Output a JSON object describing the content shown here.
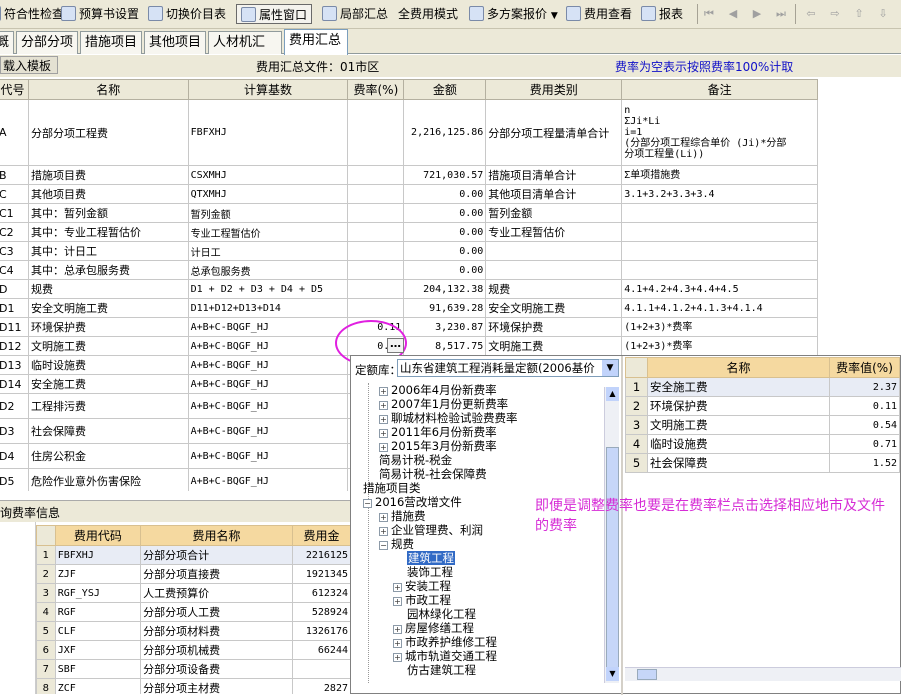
{
  "toolbar": {
    "items": [
      {
        "label": "符合性检查",
        "icon": "check-icon"
      },
      {
        "label": "预算书设置",
        "icon": "settings-icon"
      },
      {
        "label": "切换价目表",
        "icon": "switch-icon"
      },
      {
        "label": "属性窗口",
        "icon": "property-window-icon"
      },
      {
        "label": "局部汇总",
        "icon": "partial-summary-icon"
      },
      {
        "label": "全费用模式",
        "icon": ""
      },
      {
        "label": "多方案报价",
        "icon": "multi-plan-icon"
      },
      {
        "label": "费用查看",
        "icon": "cost-view-icon"
      },
      {
        "label": "报表",
        "icon": "report-icon"
      }
    ]
  },
  "tabs": [
    "概况",
    "分部分项",
    "措施项目",
    "其他项目",
    "人材机汇总",
    "费用汇总"
  ],
  "subbar": {
    "load_template": "载入模板",
    "file_label": "费用汇总文件：01市区",
    "note": "费率为空表示按照费率100%计取"
  },
  "main_table": {
    "headers": [
      "代号",
      "名称",
      "计算基数",
      "费率(%)",
      "金额",
      "费用类别",
      "备注"
    ],
    "rows": [
      {
        "code": "A",
        "name": "分部分项工程费",
        "base": "FBFXHJ",
        "rate": "",
        "amount": "2,216,125.86",
        "category": "分部分项工程量清单合计",
        "note_lines": [
          "n",
          "ΣJi*Li",
          "i=1",
          "(分部分项工程综合单价 (Ji)*分部",
          "分项工程量(Li))"
        ]
      },
      {
        "code": "B",
        "name": "措施项目费",
        "base": "CSXMHJ",
        "rate": "",
        "amount": "721,030.57",
        "category": "措施项目清单合计",
        "note_lines": [
          "Σ单项措施费"
        ]
      },
      {
        "code": "C",
        "name": "其他项目费",
        "base": "QTXMHJ",
        "rate": "",
        "amount": "0.00",
        "category": "其他项目清单合计",
        "note_lines": [
          "3.1+3.2+3.3+3.4"
        ]
      },
      {
        "code": "C1",
        "name": "其中：暂列金额",
        "base": "暂列金额",
        "rate": "",
        "amount": "0.00",
        "category": "暂列金额",
        "note_lines": [
          ""
        ]
      },
      {
        "code": "C2",
        "name": "其中：专业工程暂估价",
        "base": "专业工程暂估价",
        "rate": "",
        "amount": "0.00",
        "category": "专业工程暂估价",
        "note_lines": [
          ""
        ]
      },
      {
        "code": "C3",
        "name": "其中：计日工",
        "base": "计日工",
        "rate": "",
        "amount": "0.00",
        "category": "",
        "note_lines": [
          ""
        ]
      },
      {
        "code": "C4",
        "name": "其中：总承包服务费",
        "base": "总承包服务费",
        "rate": "",
        "amount": "0.00",
        "category": "",
        "note_lines": [
          ""
        ]
      },
      {
        "code": "D",
        "name": "规费",
        "base": "D1 + D2 + D3 + D4 + D5",
        "rate": "",
        "amount": "204,132.38",
        "category": "规费",
        "note_lines": [
          "4.1+4.2+4.3+4.4+4.5"
        ]
      },
      {
        "code": "D1",
        "name": "安全文明施工费",
        "base": "D11+D12+D13+D14",
        "rate": "",
        "amount": "91,639.28",
        "category": "安全文明施工费",
        "note_lines": [
          "4.1.1+4.1.2+4.1.3+4.1.4"
        ]
      },
      {
        "code": "D11",
        "name": "环境保护费",
        "base": "A+B+C-BQGF_HJ",
        "rate": "0.11",
        "amount": "3,230.87",
        "category": "环境保护费",
        "note_lines": [
          "(1+2+3)*费率"
        ]
      },
      {
        "code": "D12",
        "name": "文明施工费",
        "base": "A+B+C-BQGF_HJ",
        "rate": "0.29",
        "amount": "8,517.75",
        "category": "文明施工费",
        "note_lines": [
          "(1+2+3)*费率"
        ]
      },
      {
        "code": "D13",
        "name": "临时设施费",
        "base": "A+B+C-BQGF_HJ",
        "rate": "",
        "amount": "",
        "category": "",
        "note_lines": [
          ""
        ]
      },
      {
        "code": "D14",
        "name": "安全施工费",
        "base": "A+B+C-BQGF_HJ",
        "rate": "",
        "amount": "",
        "category": "",
        "note_lines": [
          ""
        ]
      },
      {
        "code": "D2",
        "name": "工程排污费",
        "base": "A+B+C-BQGF_HJ",
        "rate": "",
        "amount": "",
        "category": "",
        "note_lines": [
          ""
        ]
      },
      {
        "code": "D3",
        "name": "社会保障费",
        "base": "A+B+C-BQGF_HJ",
        "rate": "",
        "amount": "",
        "category": "",
        "note_lines": [
          ""
        ]
      },
      {
        "code": "D4",
        "name": "住房公积金",
        "base": "A+B+C-BQGF_HJ",
        "rate": "",
        "amount": "",
        "category": "",
        "note_lines": [
          ""
        ]
      },
      {
        "code": "D5",
        "name": "危险作业意外伤害保险",
        "base": "A+B+C-BQGF_HJ",
        "rate": "",
        "amount": "",
        "category": "",
        "note_lines": [
          ""
        ]
      }
    ]
  },
  "lower": {
    "title": "查询费率信息",
    "headers": [
      "费用代码",
      "费用名称",
      "费用金"
    ],
    "rows": [
      [
        "1",
        "FBFXHJ",
        "分部分项合计",
        "2216125"
      ],
      [
        "2",
        "ZJF",
        "分部分项直接费",
        "1921345"
      ],
      [
        "3",
        "RGF_YSJ",
        "人工费预算价",
        "612324"
      ],
      [
        "4",
        "RGF",
        "分部分项人工费",
        "528924"
      ],
      [
        "5",
        "CLF",
        "分部分项材料费",
        "1326176"
      ],
      [
        "6",
        "JXF",
        "分部分项机械费",
        "66244"
      ],
      [
        "7",
        "SBF",
        "分部分项设备费",
        ""
      ],
      [
        "8",
        "ZCF",
        "分部分项主材费",
        "2827"
      ]
    ]
  },
  "popup": {
    "lib_label": "定额库：",
    "lib_value": "山东省建筑工程消耗量定额(2006基价",
    "tree": [
      {
        "label": "2006年4月份新费率",
        "level": 1,
        "pm": "+"
      },
      {
        "label": "2007年1月份更新费率",
        "level": 1,
        "pm": "+"
      },
      {
        "label": "聊城材料检验试验费费率",
        "level": 1,
        "pm": "+"
      },
      {
        "label": "2011年6月份新费率",
        "level": 1,
        "pm": "+"
      },
      {
        "label": "2015年3月份新费率",
        "level": 1,
        "pm": "+"
      },
      {
        "label": "简易计税-税金",
        "level": 1,
        "pm": ""
      },
      {
        "label": "简易计税-社会保障费",
        "level": 1,
        "pm": ""
      },
      {
        "label": "措施项目类",
        "level": 0,
        "pm": ""
      },
      {
        "label": "2016营改增文件",
        "level": 0,
        "pm": "-"
      },
      {
        "label": "措施费",
        "level": 1,
        "pm": "+"
      },
      {
        "label": "企业管理费、利润",
        "level": 1,
        "pm": "+"
      },
      {
        "label": "规费",
        "level": 1,
        "pm": "-"
      },
      {
        "label": "建筑工程",
        "level": 2,
        "pm": "",
        "selected": true
      },
      {
        "label": "装饰工程",
        "level": 2,
        "pm": ""
      },
      {
        "label": "安装工程",
        "level": 2,
        "pm": "+"
      },
      {
        "label": "市政工程",
        "level": 2,
        "pm": "+"
      },
      {
        "label": "园林绿化工程",
        "level": 2,
        "pm": ""
      },
      {
        "label": "房屋修缮工程",
        "level": 2,
        "pm": "+"
      },
      {
        "label": "市政养护维修工程",
        "level": 2,
        "pm": "+"
      },
      {
        "label": "城市轨道交通工程",
        "level": 2,
        "pm": "+"
      },
      {
        "label": "仿古建筑工程",
        "level": 2,
        "pm": ""
      }
    ],
    "rate_headers": [
      "名称",
      "费率值(%)"
    ],
    "rate_rows": [
      [
        "1",
        "安全施工费",
        "2.37"
      ],
      [
        "2",
        "环境保护费",
        "0.11"
      ],
      [
        "3",
        "文明施工费",
        "0.54"
      ],
      [
        "4",
        "临时设施费",
        "0.71"
      ],
      [
        "5",
        "社会保障费",
        "1.52"
      ]
    ],
    "annotation": "即便是调整费率也要是在费率栏点击选择相应地市及文件的费率"
  },
  "colors": {
    "annotation": "#d62cd6",
    "note_blue": "#1010c8",
    "header_orange": "#f5d9a0",
    "circle": "#e020e0"
  }
}
